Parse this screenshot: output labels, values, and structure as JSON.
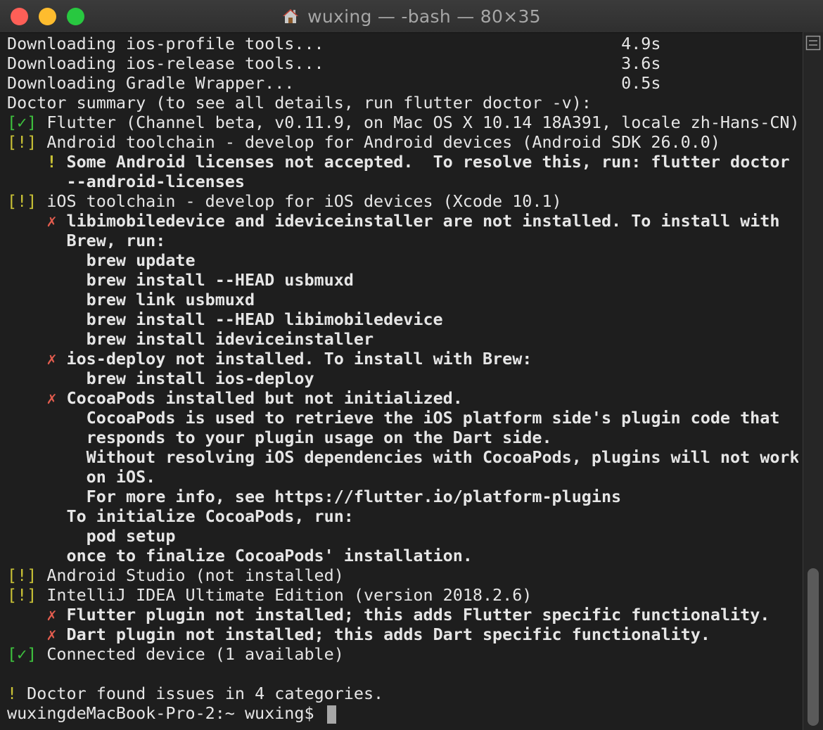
{
  "window": {
    "title": "wuxing — -bash — 80×35"
  },
  "icons": {
    "home": "home-icon",
    "scroll_button": "split-pane-icon"
  },
  "colors": {
    "ok": "#3ec13e",
    "warn": "#c9c236",
    "error": "#e25c4e",
    "text": "#e6e6e6",
    "background": "#1e1e1e"
  },
  "terminal": {
    "lines": [
      "Downloading ios-profile tools...                              4.9s",
      "Downloading ios-release tools...                              3.6s",
      "Downloading Gradle Wrapper...                                 0.5s",
      "Doctor summary (to see all details, run flutter doctor -v):",
      {
        "mark": "[✓]",
        "text": " Flutter (Channel beta, v0.11.9, on Mac OS X 10.14 18A391, locale zh-Hans-CN)"
      },
      {
        "mark": "[!]",
        "text": " Android toolchain - develop for Android devices (Android SDK 26.0.0)"
      },
      {
        "mark": "!",
        "text": " Some Android licenses not accepted.  To resolve this, run: flutter doctor"
      },
      "      --android-licenses",
      {
        "mark": "[!]",
        "text": " iOS toolchain - develop for iOS devices (Xcode 10.1)"
      },
      {
        "mark": "✗",
        "text": " libimobiledevice and ideviceinstaller are not installed. To install with"
      },
      "      Brew, run:",
      "        brew update",
      "        brew install --HEAD usbmuxd",
      "        brew link usbmuxd",
      "        brew install --HEAD libimobiledevice",
      "        brew install ideviceinstaller",
      {
        "mark": "✗",
        "text": " ios-deploy not installed. To install with Brew:"
      },
      "        brew install ios-deploy",
      {
        "mark": "✗",
        "text": " CocoaPods installed but not initialized."
      },
      "        CocoaPods is used to retrieve the iOS platform side's plugin code that",
      "        responds to your plugin usage on the Dart side.",
      "        Without resolving iOS dependencies with CocoaPods, plugins will not work",
      "        on iOS.",
      "        For more info, see https://flutter.io/platform-plugins",
      "      To initialize CocoaPods, run:",
      "        pod setup",
      "      once to finalize CocoaPods' installation.",
      {
        "mark": "[!]",
        "text": " Android Studio (not installed)"
      },
      {
        "mark": "[!]",
        "text": " IntelliJ IDEA Ultimate Edition (version 2018.2.6)"
      },
      {
        "mark": "✗",
        "text": " Flutter plugin not installed; this adds Flutter specific functionality."
      },
      {
        "mark": "✗",
        "text": " Dart plugin not installed; this adds Dart specific functionality."
      },
      {
        "mark": "[✓]",
        "text": " Connected device (1 available)"
      },
      "",
      {
        "mark": "!",
        "text": " Doctor found issues in 4 categories."
      }
    ],
    "prompt": "wuxingdeMacBook-Pro-2:~ wuxing$ "
  }
}
